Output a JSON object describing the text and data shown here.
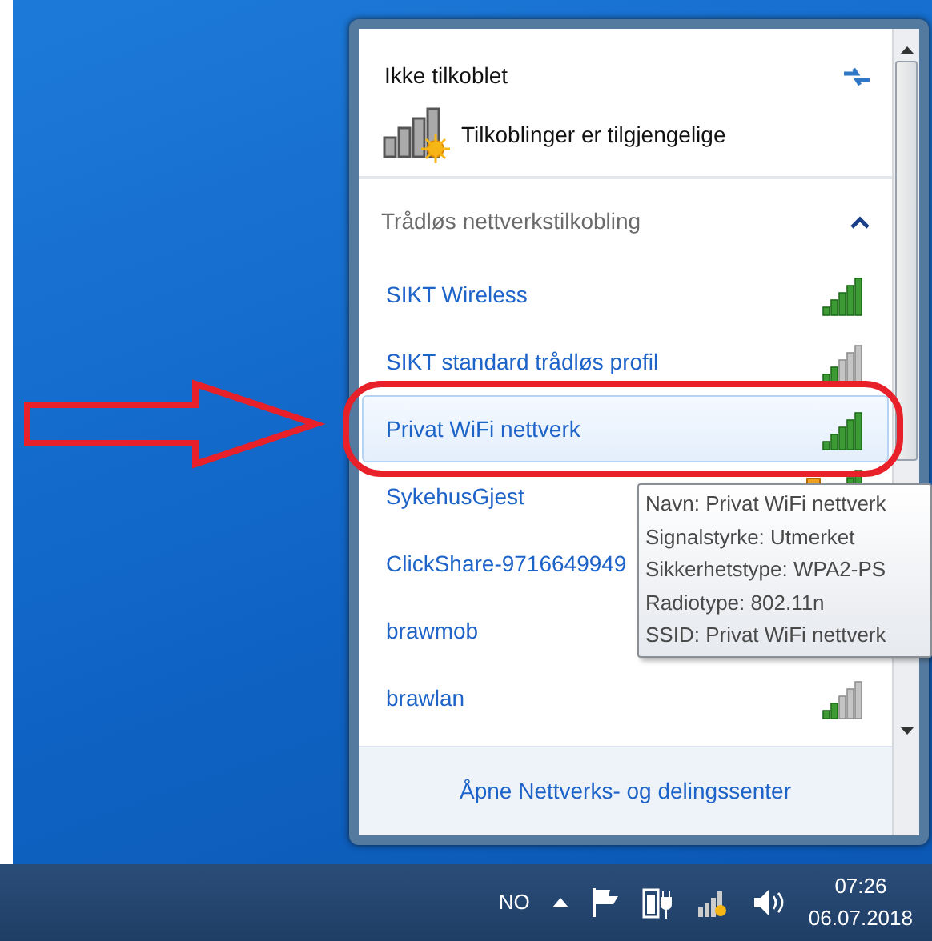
{
  "popup": {
    "status": "Ikke tilkoblet",
    "availability": "Tilkoblinger er tilgjengelige",
    "section": {
      "title": "Trådløs nettverkstilkobling",
      "expanded": true
    },
    "networks": [
      {
        "name": "SIKT Wireless",
        "level": 1,
        "warning": false,
        "selected": false
      },
      {
        "name": "SIKT standard trådløs profil",
        "level": 0.4,
        "warning": false,
        "selected": false
      },
      {
        "name": "Privat WiFi nettverk",
        "level": 1,
        "warning": false,
        "selected": true
      },
      {
        "name": "SykehusGjest",
        "level": 1,
        "warning": true,
        "selected": false
      },
      {
        "name": "ClickShare-9716649949",
        "selected": false
      },
      {
        "name": "brawmob",
        "selected": false
      },
      {
        "name": "brawlan",
        "level": 0.4,
        "warning": false,
        "selected": false
      }
    ],
    "footer_link": "Åpne Nettverks- og delingssenter",
    "tooltip": [
      "Navn: Privat WiFi nettverk",
      "Signalstyrke: Utmerket",
      "Sikkerhetstype: WPA2-PS",
      "Radiotype: 802.11n",
      "SSID: Privat WiFi nettverk"
    ]
  },
  "taskbar": {
    "language": "NO",
    "time": "07:26",
    "date": "06.07.2018"
  }
}
